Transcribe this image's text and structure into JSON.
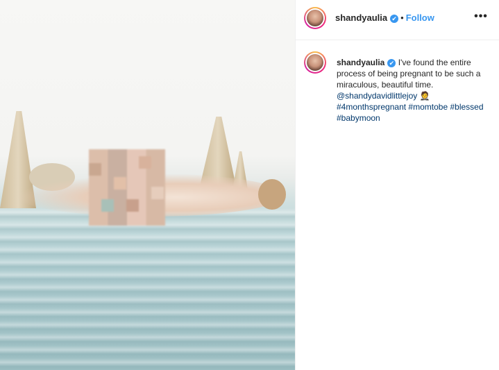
{
  "post": {
    "username": "shandyaulia",
    "verified_mark": "✔",
    "separator": "•",
    "follow_label": "Follow",
    "more_icon": "•••",
    "caption": {
      "text": "I've found the entire process of being pregnant to be such a miraculous, beautiful time.",
      "mention": "@shandydavidlittlejoy",
      "emoji": "🤵",
      "hashtags": [
        "#4monthspregnant",
        "#momtobe",
        "#blessed",
        "#babymoon"
      ]
    }
  },
  "icons": {
    "verified": "verified-badge-icon",
    "more": "more-options-icon"
  },
  "colors": {
    "link_blue": "#3897f0",
    "hashtag": "#00376b",
    "verified": "#3897f0"
  }
}
